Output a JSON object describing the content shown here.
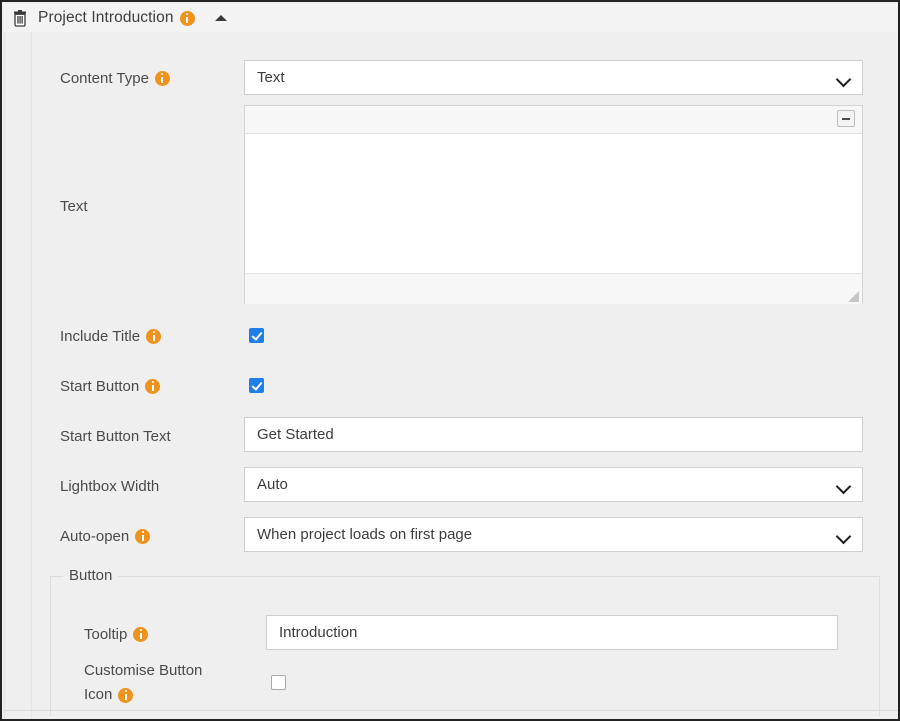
{
  "panel": {
    "title": "Project Introduction",
    "delete_icon": "trash-icon",
    "info_icon": "info-icon",
    "collapse_icon": "collapse-up-arrow-icon"
  },
  "fields": {
    "content_type": {
      "label": "Content Type",
      "value": "Text",
      "has_info": true
    },
    "text": {
      "label": "Text",
      "value": "",
      "has_info": false,
      "toolbar_button": "toolbar-toggle-icon"
    },
    "include_title": {
      "label": "Include Title",
      "checked": true,
      "has_info": true
    },
    "start_button": {
      "label": "Start Button",
      "checked": true,
      "has_info": true
    },
    "start_button_text": {
      "label": "Start Button Text",
      "value": "Get Started",
      "has_info": false
    },
    "lightbox_width": {
      "label": "Lightbox Width",
      "value": "Auto",
      "has_info": false
    },
    "auto_open": {
      "label": "Auto-open",
      "value": "When project loads on first page",
      "has_info": true
    }
  },
  "button_section": {
    "legend": "Button",
    "tooltip": {
      "label": "Tooltip",
      "value": "Introduction",
      "has_info": true
    },
    "customise_button_icon": {
      "label_line1": "Customise Button",
      "label_line2": "Icon",
      "checked": false,
      "has_info": true
    }
  },
  "colors": {
    "info_orange": "#f0921e",
    "checkbox_blue": "#1f7fe8",
    "panel_background": "#efefef",
    "field_background": "#ffffff",
    "border": "#cfcfcf"
  }
}
